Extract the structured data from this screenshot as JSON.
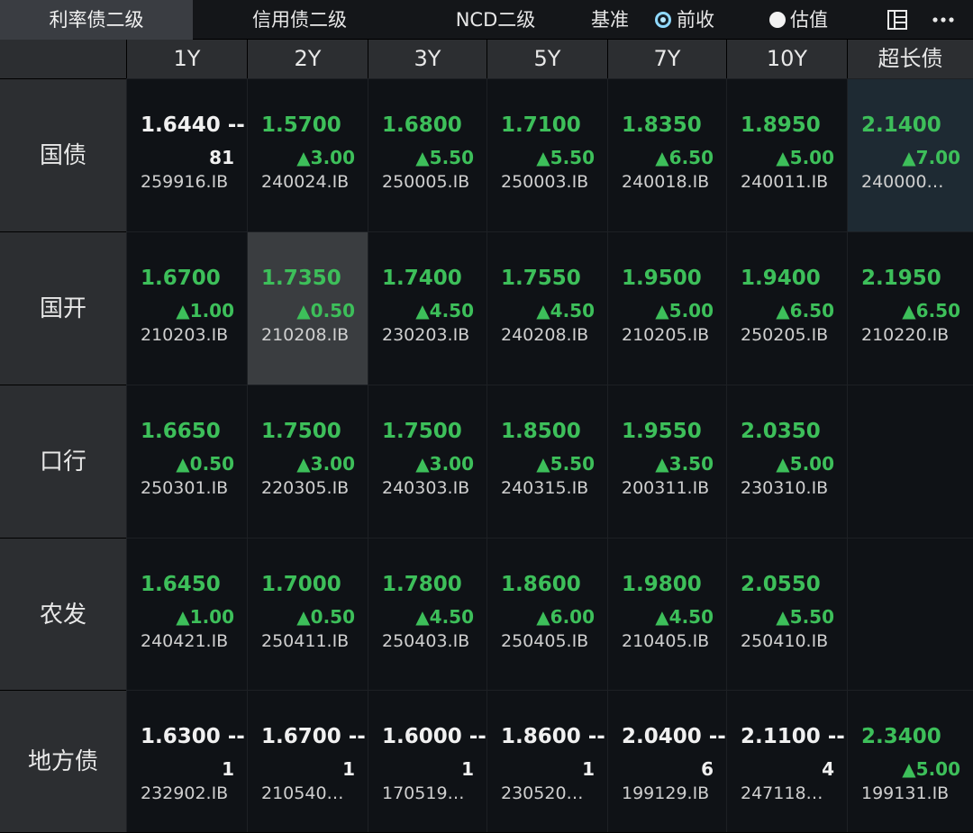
{
  "tabs": [
    "利率债二级",
    "信用债二级",
    "NCD二级"
  ],
  "base": {
    "label": "基准",
    "options": [
      "前收",
      "估值"
    ],
    "selected": "前收"
  },
  "icons": [
    "layout-icon",
    "more-icon"
  ],
  "columns": [
    "1Y",
    "2Y",
    "3Y",
    "5Y",
    "7Y",
    "10Y",
    "超长债"
  ],
  "rows": [
    {
      "name": "国债",
      "cells": [
        {
          "price": "1.6440 --",
          "chg": "81",
          "code": "259916.IB",
          "dir": "flat"
        },
        {
          "price": "1.5700",
          "chg": "▲3.00",
          "code": "240024.IB",
          "dir": "up"
        },
        {
          "price": "1.6800",
          "chg": "▲5.50",
          "code": "250005.IB",
          "dir": "up"
        },
        {
          "price": "1.7100",
          "chg": "▲5.50",
          "code": "250003.IB",
          "dir": "up"
        },
        {
          "price": "1.8350",
          "chg": "▲6.50",
          "code": "240018.IB",
          "dir": "up"
        },
        {
          "price": "1.8950",
          "chg": "▲5.00",
          "code": "240011.IB",
          "dir": "up"
        },
        {
          "price": "2.1400",
          "chg": "▲7.00",
          "code": "240000…",
          "dir": "up",
          "highlight": "blue"
        }
      ]
    },
    {
      "name": "国开",
      "cells": [
        {
          "price": "1.6700",
          "chg": "▲1.00",
          "code": "210203.IB",
          "dir": "up"
        },
        {
          "price": "1.7350",
          "chg": "▲0.50",
          "code": "210208.IB",
          "dir": "up",
          "highlight": "gray"
        },
        {
          "price": "1.7400",
          "chg": "▲4.50",
          "code": "230203.IB",
          "dir": "up"
        },
        {
          "price": "1.7550",
          "chg": "▲4.50",
          "code": "240208.IB",
          "dir": "up"
        },
        {
          "price": "1.9500",
          "chg": "▲5.00",
          "code": "210205.IB",
          "dir": "up"
        },
        {
          "price": "1.9400",
          "chg": "▲6.50",
          "code": "250205.IB",
          "dir": "up"
        },
        {
          "price": "2.1950",
          "chg": "▲6.50",
          "code": "210220.IB",
          "dir": "up"
        }
      ]
    },
    {
      "name": "口行",
      "cells": [
        {
          "price": "1.6650",
          "chg": "▲0.50",
          "code": "250301.IB",
          "dir": "up"
        },
        {
          "price": "1.7500",
          "chg": "▲3.00",
          "code": "220305.IB",
          "dir": "up"
        },
        {
          "price": "1.7500",
          "chg": "▲3.00",
          "code": "240303.IB",
          "dir": "up"
        },
        {
          "price": "1.8500",
          "chg": "▲5.50",
          "code": "240315.IB",
          "dir": "up"
        },
        {
          "price": "1.9550",
          "chg": "▲3.50",
          "code": "200311.IB",
          "dir": "up"
        },
        {
          "price": "2.0350",
          "chg": "▲5.00",
          "code": "230310.IB",
          "dir": "up"
        },
        null
      ]
    },
    {
      "name": "农发",
      "cells": [
        {
          "price": "1.6450",
          "chg": "▲1.00",
          "code": "240421.IB",
          "dir": "up"
        },
        {
          "price": "1.7000",
          "chg": "▲0.50",
          "code": "250411.IB",
          "dir": "up"
        },
        {
          "price": "1.7800",
          "chg": "▲4.50",
          "code": "250403.IB",
          "dir": "up"
        },
        {
          "price": "1.8600",
          "chg": "▲6.00",
          "code": "250405.IB",
          "dir": "up"
        },
        {
          "price": "1.9800",
          "chg": "▲4.50",
          "code": "210405.IB",
          "dir": "up"
        },
        {
          "price": "2.0550",
          "chg": "▲5.50",
          "code": "250410.IB",
          "dir": "up"
        },
        null
      ]
    },
    {
      "name": "地方债",
      "cells": [
        {
          "price": "1.6300 --",
          "chg": "1",
          "code": "232902.IB",
          "dir": "flat"
        },
        {
          "price": "1.6700 --",
          "chg": "1",
          "code": "210540…",
          "dir": "flat"
        },
        {
          "price": "1.6000 --",
          "chg": "1",
          "code": "170519…",
          "dir": "flat"
        },
        {
          "price": "1.8600 --",
          "chg": "1",
          "code": "230520…",
          "dir": "flat"
        },
        {
          "price": "2.0400 --",
          "chg": "6",
          "code": "199129.IB",
          "dir": "flat"
        },
        {
          "price": "2.1100 --",
          "chg": "4",
          "code": "247118…",
          "dir": "flat"
        },
        {
          "price": "2.3400",
          "chg": "▲5.00",
          "code": "199131.IB",
          "dir": "up"
        }
      ]
    }
  ]
}
